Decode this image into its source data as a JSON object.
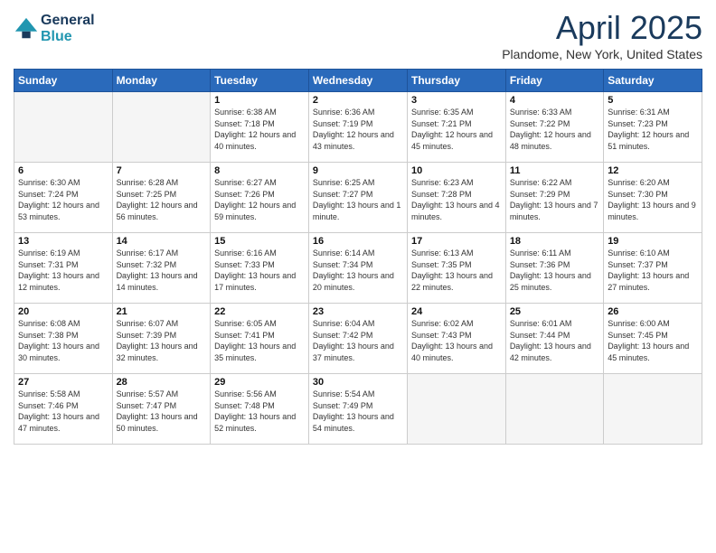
{
  "logo": {
    "line1": "General",
    "line2": "Blue"
  },
  "title": "April 2025",
  "location": "Plandome, New York, United States",
  "weekdays": [
    "Sunday",
    "Monday",
    "Tuesday",
    "Wednesday",
    "Thursday",
    "Friday",
    "Saturday"
  ],
  "weeks": [
    [
      {
        "day": "",
        "info": ""
      },
      {
        "day": "",
        "info": ""
      },
      {
        "day": "1",
        "info": "Sunrise: 6:38 AM\nSunset: 7:18 PM\nDaylight: 12 hours and 40 minutes."
      },
      {
        "day": "2",
        "info": "Sunrise: 6:36 AM\nSunset: 7:19 PM\nDaylight: 12 hours and 43 minutes."
      },
      {
        "day": "3",
        "info": "Sunrise: 6:35 AM\nSunset: 7:21 PM\nDaylight: 12 hours and 45 minutes."
      },
      {
        "day": "4",
        "info": "Sunrise: 6:33 AM\nSunset: 7:22 PM\nDaylight: 12 hours and 48 minutes."
      },
      {
        "day": "5",
        "info": "Sunrise: 6:31 AM\nSunset: 7:23 PM\nDaylight: 12 hours and 51 minutes."
      }
    ],
    [
      {
        "day": "6",
        "info": "Sunrise: 6:30 AM\nSunset: 7:24 PM\nDaylight: 12 hours and 53 minutes."
      },
      {
        "day": "7",
        "info": "Sunrise: 6:28 AM\nSunset: 7:25 PM\nDaylight: 12 hours and 56 minutes."
      },
      {
        "day": "8",
        "info": "Sunrise: 6:27 AM\nSunset: 7:26 PM\nDaylight: 12 hours and 59 minutes."
      },
      {
        "day": "9",
        "info": "Sunrise: 6:25 AM\nSunset: 7:27 PM\nDaylight: 13 hours and 1 minute."
      },
      {
        "day": "10",
        "info": "Sunrise: 6:23 AM\nSunset: 7:28 PM\nDaylight: 13 hours and 4 minutes."
      },
      {
        "day": "11",
        "info": "Sunrise: 6:22 AM\nSunset: 7:29 PM\nDaylight: 13 hours and 7 minutes."
      },
      {
        "day": "12",
        "info": "Sunrise: 6:20 AM\nSunset: 7:30 PM\nDaylight: 13 hours and 9 minutes."
      }
    ],
    [
      {
        "day": "13",
        "info": "Sunrise: 6:19 AM\nSunset: 7:31 PM\nDaylight: 13 hours and 12 minutes."
      },
      {
        "day": "14",
        "info": "Sunrise: 6:17 AM\nSunset: 7:32 PM\nDaylight: 13 hours and 14 minutes."
      },
      {
        "day": "15",
        "info": "Sunrise: 6:16 AM\nSunset: 7:33 PM\nDaylight: 13 hours and 17 minutes."
      },
      {
        "day": "16",
        "info": "Sunrise: 6:14 AM\nSunset: 7:34 PM\nDaylight: 13 hours and 20 minutes."
      },
      {
        "day": "17",
        "info": "Sunrise: 6:13 AM\nSunset: 7:35 PM\nDaylight: 13 hours and 22 minutes."
      },
      {
        "day": "18",
        "info": "Sunrise: 6:11 AM\nSunset: 7:36 PM\nDaylight: 13 hours and 25 minutes."
      },
      {
        "day": "19",
        "info": "Sunrise: 6:10 AM\nSunset: 7:37 PM\nDaylight: 13 hours and 27 minutes."
      }
    ],
    [
      {
        "day": "20",
        "info": "Sunrise: 6:08 AM\nSunset: 7:38 PM\nDaylight: 13 hours and 30 minutes."
      },
      {
        "day": "21",
        "info": "Sunrise: 6:07 AM\nSunset: 7:39 PM\nDaylight: 13 hours and 32 minutes."
      },
      {
        "day": "22",
        "info": "Sunrise: 6:05 AM\nSunset: 7:41 PM\nDaylight: 13 hours and 35 minutes."
      },
      {
        "day": "23",
        "info": "Sunrise: 6:04 AM\nSunset: 7:42 PM\nDaylight: 13 hours and 37 minutes."
      },
      {
        "day": "24",
        "info": "Sunrise: 6:02 AM\nSunset: 7:43 PM\nDaylight: 13 hours and 40 minutes."
      },
      {
        "day": "25",
        "info": "Sunrise: 6:01 AM\nSunset: 7:44 PM\nDaylight: 13 hours and 42 minutes."
      },
      {
        "day": "26",
        "info": "Sunrise: 6:00 AM\nSunset: 7:45 PM\nDaylight: 13 hours and 45 minutes."
      }
    ],
    [
      {
        "day": "27",
        "info": "Sunrise: 5:58 AM\nSunset: 7:46 PM\nDaylight: 13 hours and 47 minutes."
      },
      {
        "day": "28",
        "info": "Sunrise: 5:57 AM\nSunset: 7:47 PM\nDaylight: 13 hours and 50 minutes."
      },
      {
        "day": "29",
        "info": "Sunrise: 5:56 AM\nSunset: 7:48 PM\nDaylight: 13 hours and 52 minutes."
      },
      {
        "day": "30",
        "info": "Sunrise: 5:54 AM\nSunset: 7:49 PM\nDaylight: 13 hours and 54 minutes."
      },
      {
        "day": "",
        "info": ""
      },
      {
        "day": "",
        "info": ""
      },
      {
        "day": "",
        "info": ""
      }
    ]
  ]
}
